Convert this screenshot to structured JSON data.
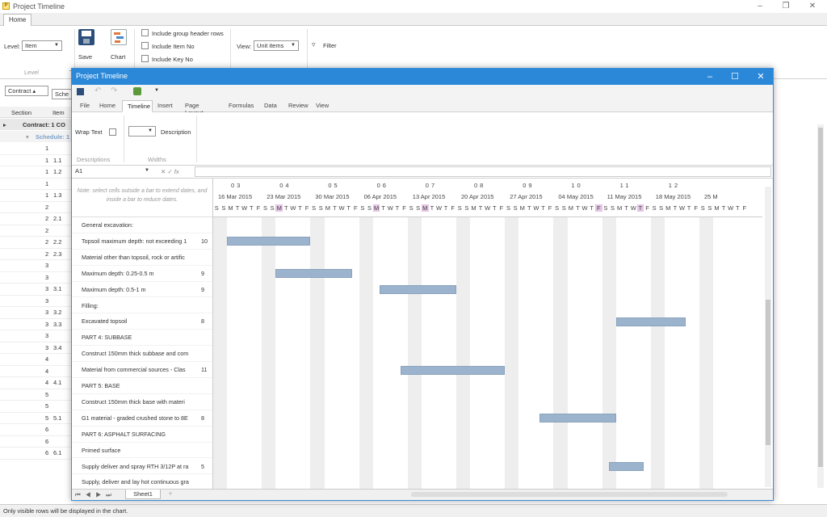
{
  "outer": {
    "title": "Project Timeline",
    "tab_home": "Home",
    "level_label": "Level:",
    "level_value": "Item",
    "save_label": "Save",
    "chart_label": "Chart",
    "opt_group_header": "Include group header rows",
    "opt_item_no": "Include Item No",
    "opt_key_no": "Include Key No",
    "view_label": "View:",
    "view_value": "Unit items",
    "filter_label": "Filter",
    "group_level": "Level",
    "contract_btn": "Contract ▴",
    "sched_btn": "Sche",
    "col_section": "Section",
    "col_item": "Item",
    "contract_row": "Contract: 1 CO",
    "schedule_row": "Schedule: 1",
    "left_rows": [
      {
        "a": "1",
        "b": ""
      },
      {
        "a": "1",
        "b": "1.1"
      },
      {
        "a": "1",
        "b": "1.2"
      },
      {
        "a": "1",
        "b": ""
      },
      {
        "a": "1",
        "b": "1.3"
      },
      {
        "a": "2",
        "b": ""
      },
      {
        "a": "2",
        "b": "2.1"
      },
      {
        "a": "2",
        "b": ""
      },
      {
        "a": "2",
        "b": "2.2"
      },
      {
        "a": "2",
        "b": "2.3"
      },
      {
        "a": "3",
        "b": ""
      },
      {
        "a": "3",
        "b": ""
      },
      {
        "a": "3",
        "b": "3.1"
      },
      {
        "a": "3",
        "b": ""
      },
      {
        "a": "3",
        "b": "3.2"
      },
      {
        "a": "3",
        "b": "3.3"
      },
      {
        "a": "3",
        "b": ""
      },
      {
        "a": "3",
        "b": "3.4"
      },
      {
        "a": "4",
        "b": ""
      },
      {
        "a": "4",
        "b": ""
      },
      {
        "a": "4",
        "b": "4.1"
      },
      {
        "a": "5",
        "b": ""
      },
      {
        "a": "5",
        "b": ""
      },
      {
        "a": "5",
        "b": "5.1"
      },
      {
        "a": "6",
        "b": ""
      },
      {
        "a": "6",
        "b": ""
      },
      {
        "a": "6",
        "b": "6.1"
      }
    ],
    "status": "Only visible rows will be displayed in the chart."
  },
  "inner": {
    "title": "Project Timeline",
    "tabs": [
      "File",
      "Home",
      "Timeline",
      "Insert",
      "Page Layout",
      "Formulas",
      "Data",
      "Review",
      "View"
    ],
    "active_tab": "Timeline",
    "wrap_text": "Wrap Text",
    "description": "Description",
    "group_descriptions": "Descriptions",
    "group_widths": "Widths",
    "namebox": "A1",
    "fx": "fx",
    "note": "Note: select cells outside a bar to extend dates, and inside a bar to reduce dates.",
    "sheet_tab": "Sheet1",
    "weeks": [
      {
        "num": "03",
        "date": "16 Mar 2015"
      },
      {
        "num": "04",
        "date": "23 Mar 2015"
      },
      {
        "num": "05",
        "date": "30 Mar 2015"
      },
      {
        "num": "06",
        "date": "06 Apr 2015"
      },
      {
        "num": "07",
        "date": "13 Apr 2015"
      },
      {
        "num": "08",
        "date": "20 Apr 2015"
      },
      {
        "num": "09",
        "date": "27 Apr 2015"
      },
      {
        "num": "10",
        "date": "04 May 2015"
      },
      {
        "num": "11",
        "date": "11 May 2015"
      },
      {
        "num": "12",
        "date": "18 May 2015"
      },
      {
        "num": "",
        "date": "25 M"
      }
    ],
    "days": [
      "S",
      "S",
      "M",
      "T",
      "W",
      "T",
      "F"
    ],
    "highlight_days": [
      9,
      23,
      30,
      55,
      61
    ],
    "rows": [
      {
        "desc": "General excavation:",
        "val": ""
      },
      {
        "desc": "Topsoil maximum depth: not exceeding 1",
        "val": "10"
      },
      {
        "desc": "Material other than topsoil, rock or artific",
        "val": ""
      },
      {
        "desc": "Maximum depth: 0.25-0.5 m",
        "val": "9"
      },
      {
        "desc": "Maximum depth: 0.5-1 m",
        "val": "9"
      },
      {
        "desc": "Filling:",
        "val": ""
      },
      {
        "desc": "Excavated topsoil",
        "val": "8"
      },
      {
        "desc": "PART 4: SUBBASE",
        "val": ""
      },
      {
        "desc": "Construct 150mm thick subbase and com",
        "val": ""
      },
      {
        "desc": "Material from commercial sources - Clas",
        "val": "11"
      },
      {
        "desc": "PART 5: BASE",
        "val": ""
      },
      {
        "desc": "Construct 150mm thick base with materi",
        "val": ""
      },
      {
        "desc": "G1 material - graded crushed stone to 8E",
        "val": "8"
      },
      {
        "desc": "PART 6: ASPHALT SURFACING",
        "val": ""
      },
      {
        "desc": "Primed surface",
        "val": ""
      },
      {
        "desc": "Supply deliver and spray RTH 3/12P at ra",
        "val": "5"
      },
      {
        "desc": "Supply, deliver and lay hot continuous gra",
        "val": ""
      }
    ],
    "bars": [
      {
        "row": 1,
        "start": "2015-03-16",
        "days": 12
      },
      {
        "row": 3,
        "start": "2015-03-23",
        "days": 11
      },
      {
        "row": 4,
        "start": "2015-04-07",
        "days": 11
      },
      {
        "row": 6,
        "start": "2015-05-11",
        "days": 10
      },
      {
        "row": 9,
        "start": "2015-04-10",
        "days": 15
      },
      {
        "row": 12,
        "start": "2015-04-30",
        "days": 11
      },
      {
        "row": 15,
        "start": "2015-05-10",
        "days": 5
      }
    ]
  }
}
